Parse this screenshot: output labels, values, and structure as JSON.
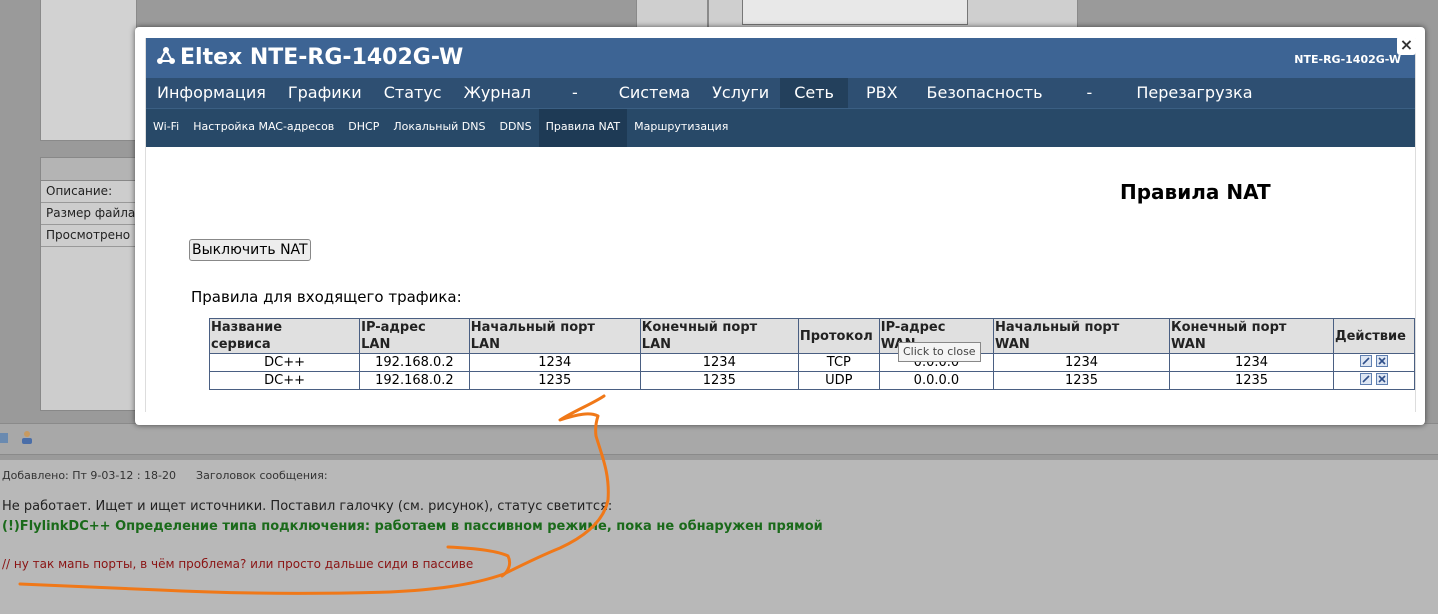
{
  "background": {
    "info_rows": [
      "Описание:",
      "Размер файла",
      "Просмотрено"
    ],
    "post_meta": {
      "added": "Добавлено: Пт 9-03-12 : 18-20",
      "subject": "Заголовок сообщения:"
    },
    "post_lines": {
      "line1": "Не работает. Ищет и ищет источники. Поставил галочку (см. рисунок), статус светится:",
      "line2": "(!)FlylinkDC++ Определение типа подключения: работаем в пассивном режиме, пока не обнаружен прямой",
      "line3": "// ну так мапь порты, в чём проблема? или просто дальше сиди в пассиве"
    }
  },
  "router": {
    "logo": "Eltex NTE-RG-1402G-W",
    "model": "NTE-RG-1402G-W",
    "menu": [
      {
        "label": "Информация"
      },
      {
        "label": "Графики"
      },
      {
        "label": "Статус"
      },
      {
        "label": "Журнал"
      },
      {
        "label": "-"
      },
      {
        "label": "Система"
      },
      {
        "label": "Услуги"
      },
      {
        "label": "Сеть",
        "active": true
      },
      {
        "label": "PBX"
      },
      {
        "label": "Безопасность"
      },
      {
        "label": "-"
      },
      {
        "label": "Перезагрузка"
      }
    ],
    "submenu": [
      {
        "label": "Wi-Fi"
      },
      {
        "label": "Настройка MAC-адресов"
      },
      {
        "label": "DHCP"
      },
      {
        "label": "Локальный DNS"
      },
      {
        "label": "DDNS"
      },
      {
        "label": "Правила NAT",
        "active": true
      },
      {
        "label": "Маршрутизация"
      }
    ],
    "page_title": "Правила NAT",
    "nat_button": "Выключить NAT",
    "section_title": "Правила для входящего трафика:",
    "table": {
      "headers": [
        [
          "Название",
          "сервиса"
        ],
        [
          "IP-адрес",
          "LAN"
        ],
        [
          "Начальный порт",
          "LAN"
        ],
        [
          "Конечный порт",
          "LAN"
        ],
        [
          "Протокол",
          ""
        ],
        [
          "IP-адрес",
          "WAN"
        ],
        [
          "Начальный порт",
          "WAN"
        ],
        [
          "Конечный порт",
          "WAN"
        ],
        [
          "Действие",
          ""
        ]
      ],
      "rows": [
        [
          "DC++",
          "192.168.0.2",
          "1234",
          "1234",
          "TCP",
          "0.0.0.0",
          "1234",
          "1234"
        ],
        [
          "DC++",
          "192.168.0.2",
          "1235",
          "1235",
          "UDP",
          "0.0.0.0",
          "1235",
          "1235"
        ]
      ]
    },
    "tooltip": "Click to close",
    "close_glyph": "×"
  },
  "colors": {
    "header": "#3d6494",
    "menu": "#2e4f72",
    "submenu": "#284968",
    "annotation": "#f07818"
  }
}
